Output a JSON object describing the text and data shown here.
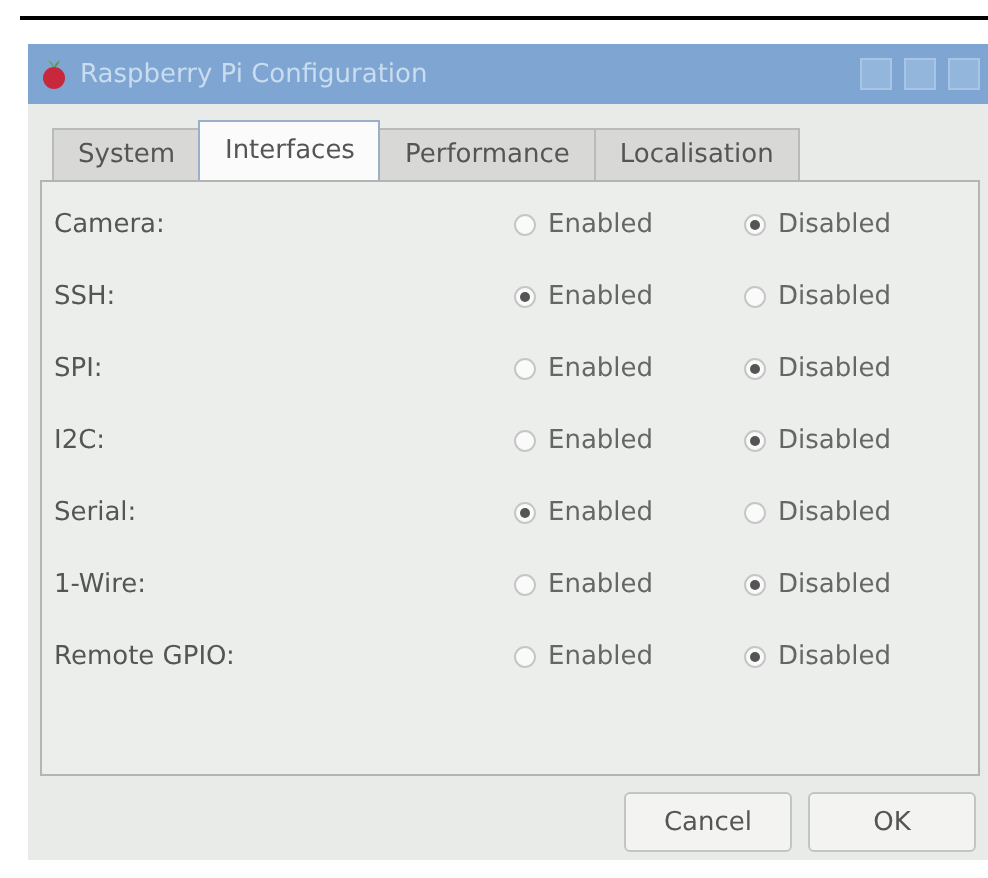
{
  "window": {
    "title": "Raspberry Pi Configuration"
  },
  "tabs": [
    {
      "label": "System",
      "selected": false
    },
    {
      "label": "Interfaces",
      "selected": true
    },
    {
      "label": "Performance",
      "selected": false
    },
    {
      "label": "Localisation",
      "selected": false
    }
  ],
  "settings": [
    {
      "label": "Camera:",
      "options": [
        {
          "label": "Enabled",
          "selected": false
        },
        {
          "label": "Disabled",
          "selected": true
        }
      ]
    },
    {
      "label": "SSH:",
      "options": [
        {
          "label": "Enabled",
          "selected": true
        },
        {
          "label": "Disabled",
          "selected": false
        }
      ]
    },
    {
      "label": "SPI:",
      "options": [
        {
          "label": "Enabled",
          "selected": false
        },
        {
          "label": "Disabled",
          "selected": true
        }
      ]
    },
    {
      "label": "I2C:",
      "options": [
        {
          "label": "Enabled",
          "selected": false
        },
        {
          "label": "Disabled",
          "selected": true
        }
      ]
    },
    {
      "label": "Serial:",
      "options": [
        {
          "label": "Enabled",
          "selected": true
        },
        {
          "label": "Disabled",
          "selected": false
        }
      ]
    },
    {
      "label": "1-Wire:",
      "options": [
        {
          "label": "Enabled",
          "selected": false
        },
        {
          "label": "Disabled",
          "selected": true
        }
      ]
    },
    {
      "label": "Remote GPIO:",
      "options": [
        {
          "label": "Enabled",
          "selected": false
        },
        {
          "label": "Disabled",
          "selected": true
        }
      ]
    }
  ],
  "buttons": [
    "Cancel",
    "OK"
  ]
}
